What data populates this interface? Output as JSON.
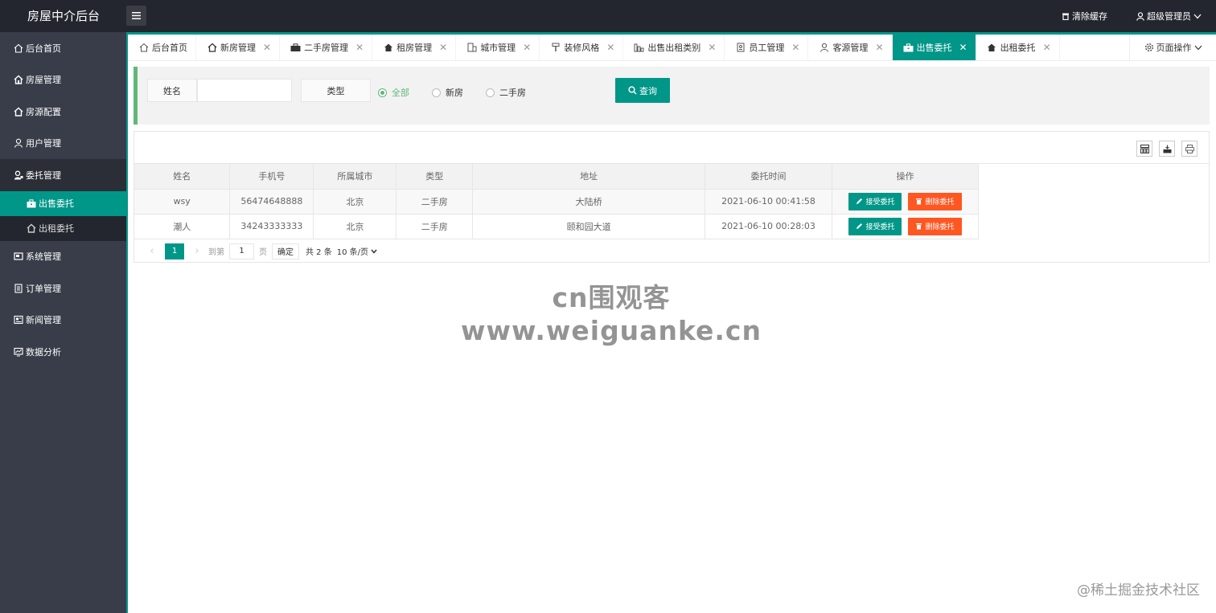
{
  "header": {
    "logo": "房屋中介后台",
    "clear_cache": "清除缓存",
    "user": "超级管理员"
  },
  "sidebar": {
    "items": [
      {
        "label": "后台首页",
        "icon": "home-icon"
      },
      {
        "label": "房屋管理",
        "icon": "house-icon"
      },
      {
        "label": "房源配置",
        "icon": "house-config-icon"
      },
      {
        "label": "用户管理",
        "icon": "user-icon"
      },
      {
        "label": "委托管理",
        "icon": "delegate-icon",
        "expanded": true
      },
      {
        "label": "系统管理",
        "icon": "system-icon"
      },
      {
        "label": "订单管理",
        "icon": "order-icon"
      },
      {
        "label": "新闻管理",
        "icon": "news-icon"
      },
      {
        "label": "数据分析",
        "icon": "chart-icon"
      }
    ],
    "sub_items": [
      {
        "label": "出售委托",
        "icon": "briefcase-icon",
        "active": true
      },
      {
        "label": "出租委托",
        "icon": "house-icon"
      }
    ]
  },
  "tabs": [
    {
      "label": "后台首页",
      "icon": "home-icon",
      "closable": false
    },
    {
      "label": "新房管理",
      "icon": "house-icon",
      "closable": true
    },
    {
      "label": "二手房管理",
      "icon": "truck-icon",
      "closable": true
    },
    {
      "label": "租房管理",
      "icon": "house-icon",
      "closable": true
    },
    {
      "label": "城市管理",
      "icon": "building-icon",
      "closable": true
    },
    {
      "label": "装修风格",
      "icon": "brush-icon",
      "closable": true
    },
    {
      "label": "出售出租类别",
      "icon": "category-icon",
      "closable": true
    },
    {
      "label": "员工管理",
      "icon": "document-icon",
      "closable": true
    },
    {
      "label": "客源管理",
      "icon": "user-icon",
      "closable": true
    },
    {
      "label": "出售委托",
      "icon": "briefcase-icon",
      "closable": true,
      "active": true
    },
    {
      "label": "出租委托",
      "icon": "house-icon",
      "closable": true
    }
  ],
  "tab_ops": "页面操作",
  "search": {
    "name_label": "姓名",
    "name_value": "",
    "type_label": "类型",
    "radios": [
      {
        "label": "全部",
        "checked": true
      },
      {
        "label": "新房",
        "checked": false
      },
      {
        "label": "二手房",
        "checked": false
      }
    ],
    "button": "查询"
  },
  "table": {
    "columns": [
      "姓名",
      "手机号",
      "所属城市",
      "类型",
      "地址",
      "委托时间",
      "操作"
    ],
    "rows": [
      {
        "name": "wsy",
        "phone": "56474648888",
        "city": "北京",
        "type": "二手房",
        "address": "大陆桥",
        "time": "2021-06-10 00:41:58"
      },
      {
        "name": "潮人",
        "phone": "34243333333",
        "city": "北京",
        "type": "二手房",
        "address": "颐和园大道",
        "time": "2021-06-10 00:28:03"
      }
    ],
    "accept_label": "接受委托",
    "delete_label": "删除委托"
  },
  "pager": {
    "current": "1",
    "goto_label": "到第",
    "goto_value": "1",
    "page_label": "页",
    "ok_label": "确定",
    "total": "共 2 条",
    "limit": "10 条/页"
  },
  "watermarks": {
    "center": "cn围观客www.weiguanke.cn",
    "corner": "@稀土掘金技术社区"
  },
  "colors": {
    "accent": "#009688",
    "sidebar_bg": "#393d49",
    "header_bg": "#23262e",
    "danger": "#ff5722",
    "radio_checked": "#5fb878"
  }
}
